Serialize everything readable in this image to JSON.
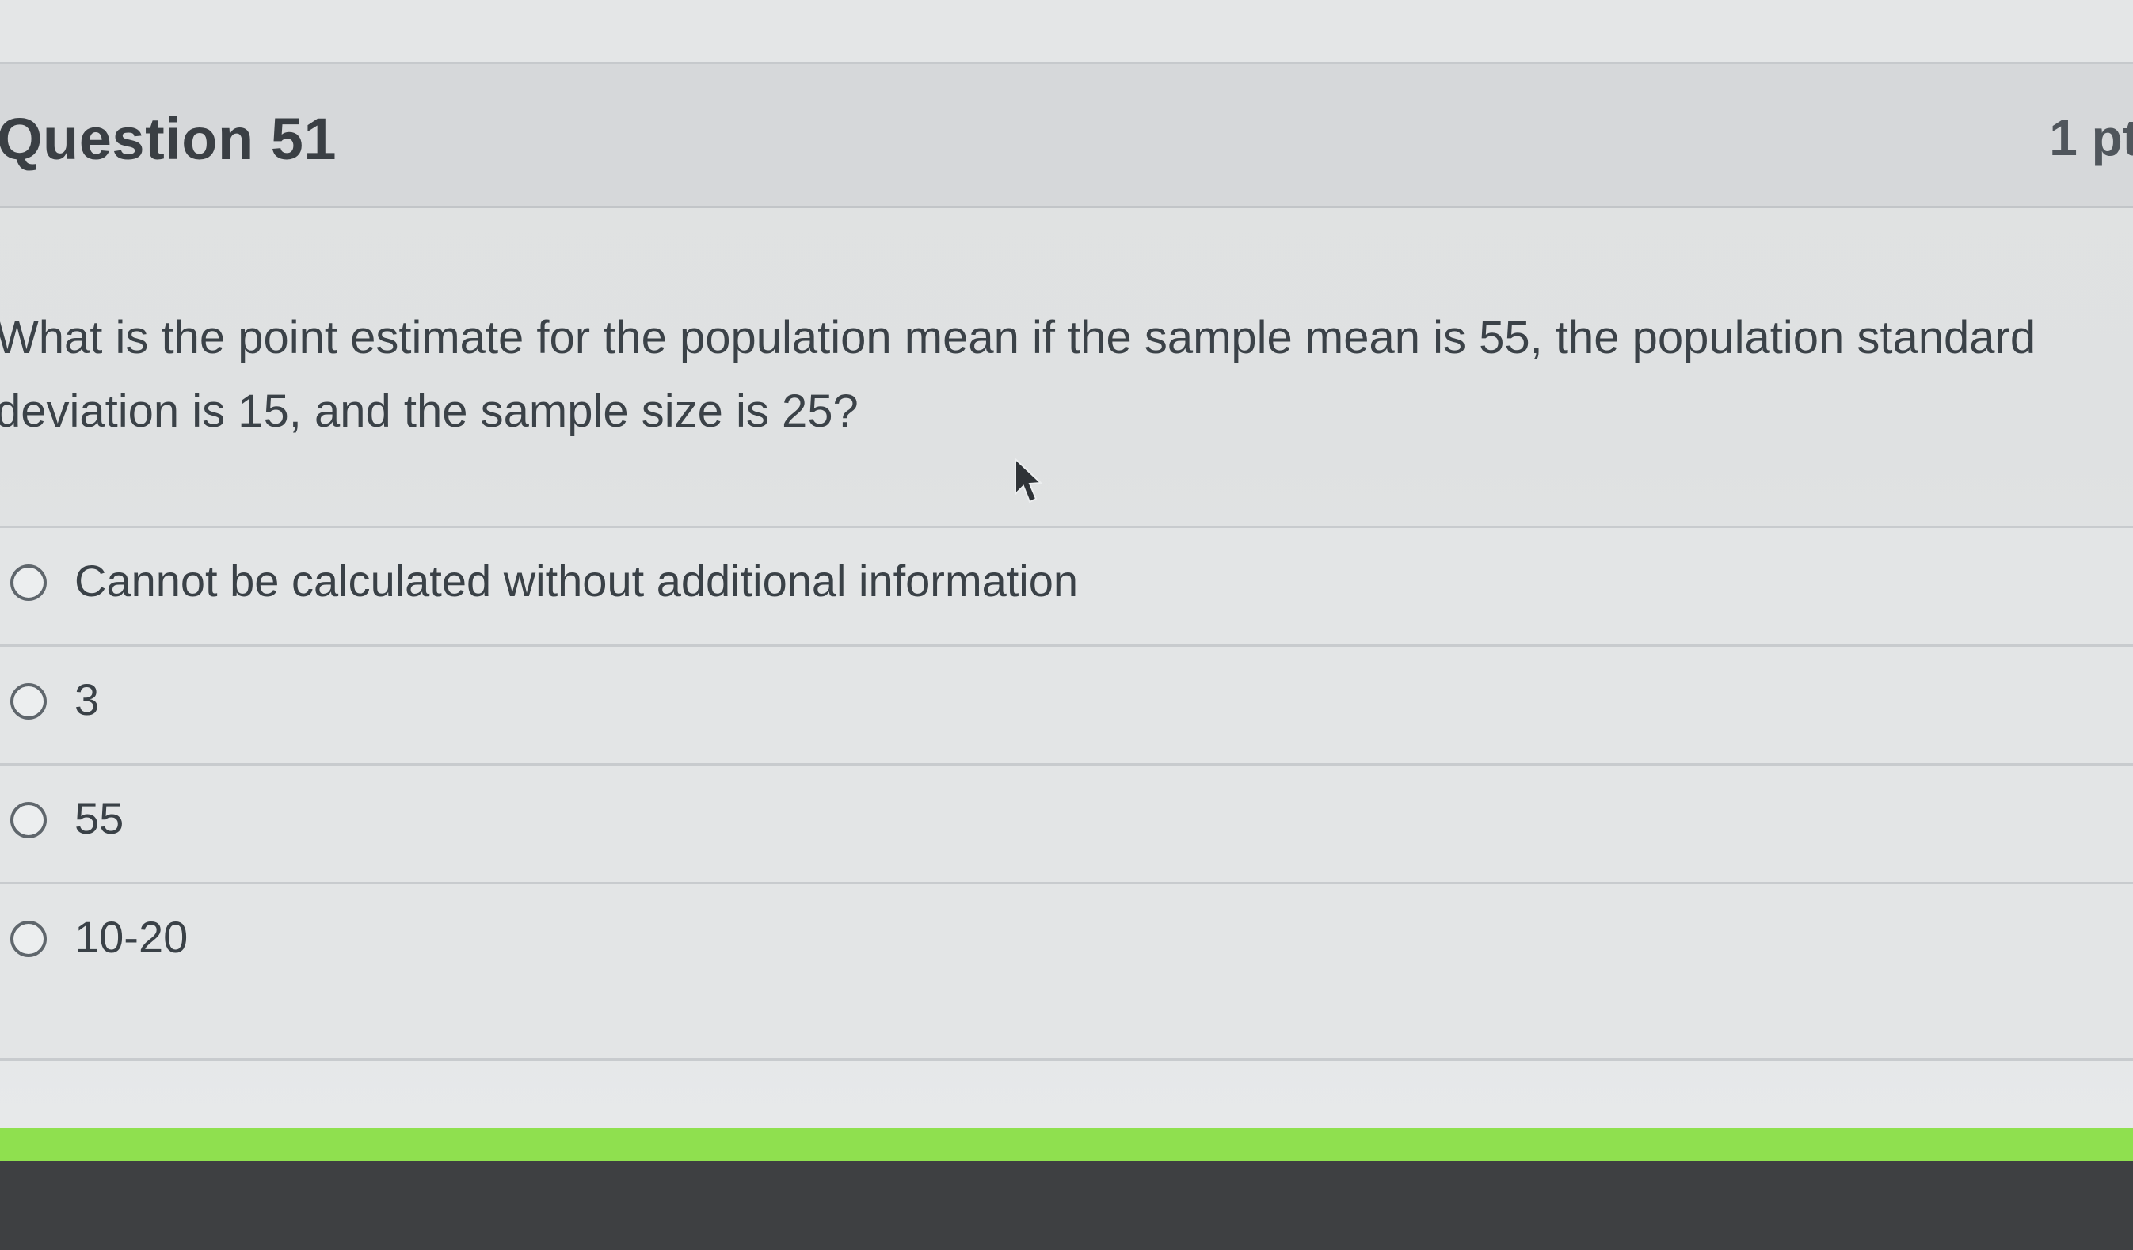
{
  "question": {
    "title": "Question 51",
    "points": "1 pt",
    "text": "What is the point estimate for the population mean if the sample mean is 55, the population standard deviation is 15, and the sample size is 25?"
  },
  "answers": [
    {
      "label": "Cannot be calculated without additional information",
      "selected": false
    },
    {
      "label": "3",
      "selected": false
    },
    {
      "label": "55",
      "selected": false
    },
    {
      "label": "10-20",
      "selected": false
    }
  ],
  "colors": {
    "accent_bar": "#8fe04f",
    "text": "#3a4147",
    "header_bg": "#d6d8da"
  },
  "icons": {
    "cursor": "mouse-pointer-icon",
    "radio": "radio-button-icon"
  }
}
